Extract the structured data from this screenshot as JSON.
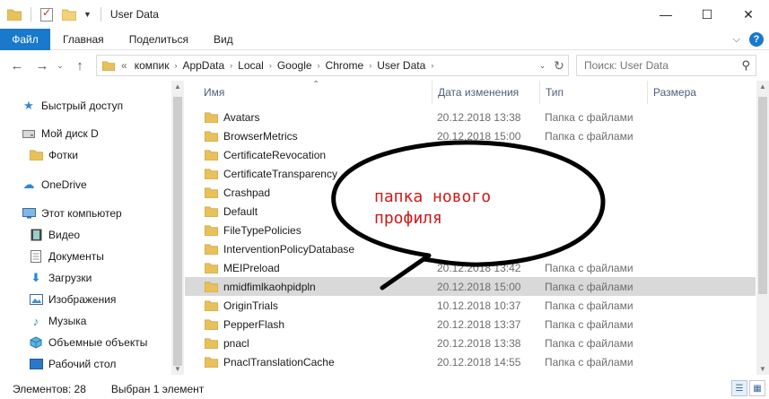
{
  "window": {
    "title": "User Data",
    "minimize": "—",
    "maximize": "☐",
    "close": "✕"
  },
  "ribbon": {
    "tabs": [
      "Файл",
      "Главная",
      "Поделиться",
      "Вид"
    ],
    "expand_icon": "chevron-down-icon",
    "help": "?"
  },
  "address": {
    "overflow": "«",
    "crumbs": [
      "компик",
      "AppData",
      "Local",
      "Google",
      "Chrome",
      "User Data"
    ]
  },
  "search": {
    "placeholder": "Поиск: User Data"
  },
  "navpane": {
    "items": [
      {
        "label": "Быстрый доступ",
        "icon": "star-icon"
      },
      {
        "label": "Мой диск D",
        "icon": "drive-icon"
      },
      {
        "label": "Фотки",
        "icon": "folder-icon"
      },
      {
        "label": "OneDrive",
        "icon": "cloud-icon"
      },
      {
        "label": "Этот компьютер",
        "icon": "computer-icon"
      },
      {
        "label": "Видео",
        "icon": "video-icon"
      },
      {
        "label": "Документы",
        "icon": "documents-icon"
      },
      {
        "label": "Загрузки",
        "icon": "download-icon"
      },
      {
        "label": "Изображения",
        "icon": "images-icon"
      },
      {
        "label": "Музыка",
        "icon": "music-icon"
      },
      {
        "label": "Объемные объекты",
        "icon": "3d-objects-icon"
      },
      {
        "label": "Рабочий стол",
        "icon": "desktop-icon"
      }
    ]
  },
  "filelist": {
    "columns": [
      "Имя",
      "Дата изменения",
      "Тип",
      "Размера"
    ],
    "rows": [
      {
        "name": "Avatars",
        "date": "20.12.2018 13:38",
        "type": "Папка с файлами"
      },
      {
        "name": "BrowserMetrics",
        "date": "20.12.2018 15:00",
        "type": "Папка с файлами"
      },
      {
        "name": "CertificateRevocation",
        "date": "",
        "type": ""
      },
      {
        "name": "CertificateTransparency",
        "date": "",
        "type": ""
      },
      {
        "name": "Crashpad",
        "date": "",
        "type": ""
      },
      {
        "name": "Default",
        "date": "",
        "type": ""
      },
      {
        "name": "FileTypePolicies",
        "date": "",
        "type": ""
      },
      {
        "name": "InterventionPolicyDatabase",
        "date": "",
        "type": ""
      },
      {
        "name": "MEIPreload",
        "date": "20.12.2018 13:42",
        "type": "Папка с файлами"
      },
      {
        "name": "nmidfimlkaohpidpln",
        "date": "20.12.2018 15:00",
        "type": "Папка с файлами",
        "selected": true
      },
      {
        "name": "OriginTrials",
        "date": "10.12.2018 10:37",
        "type": "Папка с файлами"
      },
      {
        "name": "PepperFlash",
        "date": "20.12.2018 13:37",
        "type": "Папка с файлами"
      },
      {
        "name": "pnacl",
        "date": "20.12.2018 13:38",
        "type": "Папка с файлами"
      },
      {
        "name": "PnaclTranslationCache",
        "date": "20.12.2018 14:55",
        "type": "Папка с файлами"
      }
    ]
  },
  "status": {
    "count": "Элементов: 28",
    "selected": "Выбран 1 элемент"
  },
  "annotation": {
    "line1": "папка нового",
    "line2": "профиля"
  },
  "colors": {
    "accent": "#1979ca",
    "folder": "#e8c15a",
    "annotation_text": "#d01818",
    "selected_row": "#d9d9d9"
  }
}
